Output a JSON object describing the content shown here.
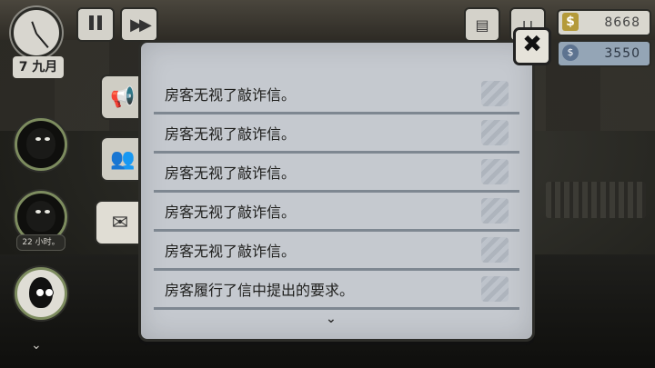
{
  "hud": {
    "date": "7 九月",
    "money": "8668",
    "money_symbol": "$",
    "points": "3550",
    "points_symbol": "$",
    "icons": [
      "clock-icon",
      "pause-icon",
      "fast-forward-icon",
      "clipboard-icon",
      "cart-icon"
    ]
  },
  "tenants": [
    {
      "name": "tenant-1"
    },
    {
      "name": "tenant-2",
      "badge": "22 小时。"
    },
    {
      "name": "tenant-3"
    }
  ],
  "tabs": [
    {
      "icon": "megaphone-icon"
    },
    {
      "icon": "people-icon"
    },
    {
      "icon": "letter-icon",
      "active": true
    }
  ],
  "log": {
    "entries": [
      "房客无视了敲诈信。",
      "房客无视了敲诈信。",
      "房客无视了敲诈信。",
      "房客无视了敲诈信。",
      "房客无视了敲诈信。",
      "房客履行了信中提出的要求。"
    ]
  },
  "close_label": "✖",
  "scroll_arrow": "⌄",
  "expand_arrow": "⌄"
}
